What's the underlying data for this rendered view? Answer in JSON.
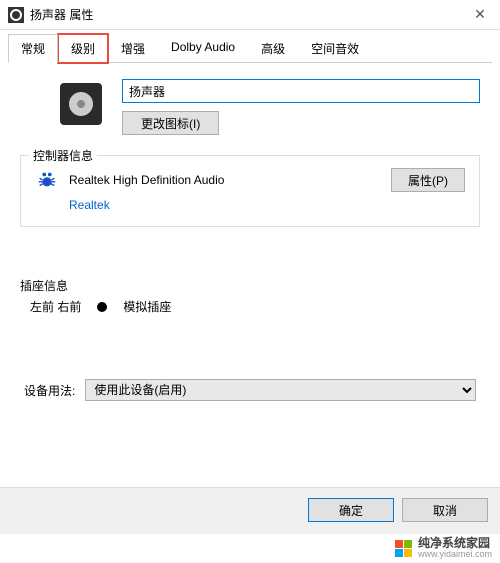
{
  "window": {
    "title": "扬声器 属性",
    "close": "✕"
  },
  "tabs": {
    "items": [
      {
        "label": "常规"
      },
      {
        "label": "级别"
      },
      {
        "label": "增强"
      },
      {
        "label": "Dolby Audio"
      },
      {
        "label": "高级"
      },
      {
        "label": "空间音效"
      }
    ]
  },
  "device": {
    "name_value": "扬声器",
    "change_icon_btn": "更改图标(I)"
  },
  "controller": {
    "legend": "控制器信息",
    "name": "Realtek High Definition Audio",
    "manufacturer": "Realtek",
    "properties_btn": "属性(P)"
  },
  "jack": {
    "legend": "插座信息",
    "position": "左前 右前",
    "type": "模拟插座"
  },
  "usage": {
    "label": "设备用法:",
    "selected": "使用此设备(启用)"
  },
  "footer": {
    "ok": "确定",
    "cancel": "取消"
  },
  "watermark": {
    "brand": "纯净系统家园",
    "url": "www.yidaimei.com"
  }
}
